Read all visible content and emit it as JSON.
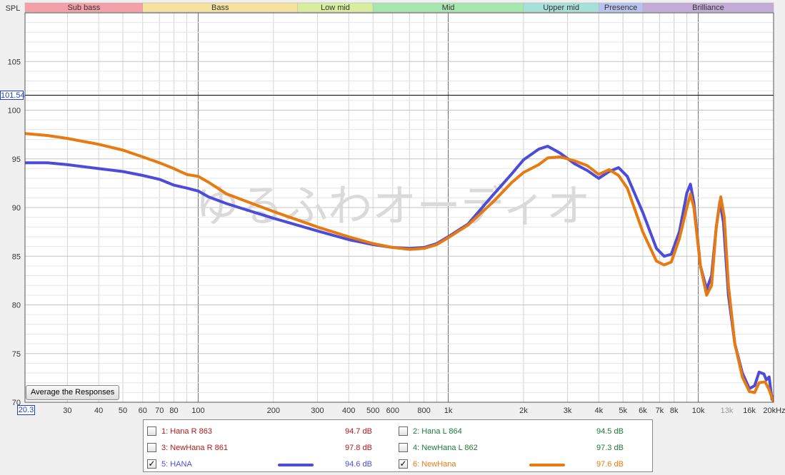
{
  "chart_data": {
    "type": "line",
    "ylabel": "SPL",
    "xscale": "log",
    "xlim": [
      20.3,
      20000
    ],
    "ylim": [
      70,
      110
    ],
    "cursor_value": "101.54",
    "cursor_db": 101.54,
    "x_cursor_label": "20.3",
    "yticks": [
      70,
      75,
      80,
      85,
      90,
      95,
      100,
      105
    ],
    "xticks": [
      {
        "f": 30,
        "label": "30"
      },
      {
        "f": 40,
        "label": "40"
      },
      {
        "f": 50,
        "label": "50"
      },
      {
        "f": 60,
        "label": "60"
      },
      {
        "f": 70,
        "label": "70"
      },
      {
        "f": 80,
        "label": "80"
      },
      {
        "f": 100,
        "label": "100"
      },
      {
        "f": 200,
        "label": "200"
      },
      {
        "f": 300,
        "label": "300"
      },
      {
        "f": 400,
        "label": "400"
      },
      {
        "f": 500,
        "label": "500"
      },
      {
        "f": 600,
        "label": "600"
      },
      {
        "f": 800,
        "label": "800"
      },
      {
        "f": 1000,
        "label": "1k"
      },
      {
        "f": 2000,
        "label": "2k"
      },
      {
        "f": 3000,
        "label": "3k"
      },
      {
        "f": 4000,
        "label": "4k"
      },
      {
        "f": 5000,
        "label": "5k"
      },
      {
        "f": 6000,
        "label": "6k"
      },
      {
        "f": 7000,
        "label": "7k"
      },
      {
        "f": 8000,
        "label": "8k"
      },
      {
        "f": 10000,
        "label": "10k"
      },
      {
        "f": 13000,
        "label": "13k",
        "dim": true
      },
      {
        "f": 16000,
        "label": "16k"
      },
      {
        "f": 20000,
        "label": "20kHz"
      }
    ],
    "bands": [
      {
        "name": "Sub bass",
        "from": 20.3,
        "to": 60,
        "color": "#f5a0a8"
      },
      {
        "name": "Bass",
        "from": 60,
        "to": 250,
        "color": "#f7e3a0"
      },
      {
        "name": "Low mid",
        "from": 250,
        "to": 500,
        "color": "#d8ee9e"
      },
      {
        "name": "Mid",
        "from": 500,
        "to": 2000,
        "color": "#a8e6b0"
      },
      {
        "name": "Upper mid",
        "from": 2000,
        "to": 4000,
        "color": "#a6e0d8"
      },
      {
        "name": "Presence",
        "from": 4000,
        "to": 6000,
        "color": "#b8c4ee"
      },
      {
        "name": "Brilliance",
        "from": 6000,
        "to": 20000,
        "color": "#c4acd8"
      }
    ],
    "watermark": "ゆるふわオーディオ",
    "series": [
      {
        "name": "HANA",
        "color": "#4c4cd8",
        "points": [
          [
            20.3,
            94.6
          ],
          [
            25,
            94.6
          ],
          [
            30,
            94.4
          ],
          [
            40,
            94.0
          ],
          [
            50,
            93.7
          ],
          [
            60,
            93.3
          ],
          [
            70,
            92.9
          ],
          [
            80,
            92.3
          ],
          [
            90,
            92.0
          ],
          [
            100,
            91.7
          ],
          [
            110,
            91.1
          ],
          [
            130,
            90.4
          ],
          [
            150,
            89.9
          ],
          [
            200,
            88.9
          ],
          [
            300,
            87.6
          ],
          [
            400,
            86.7
          ],
          [
            500,
            86.2
          ],
          [
            600,
            85.9
          ],
          [
            700,
            85.8
          ],
          [
            800,
            85.9
          ],
          [
            900,
            86.3
          ],
          [
            1000,
            87.0
          ],
          [
            1200,
            88.3
          ],
          [
            1500,
            91.2
          ],
          [
            1800,
            93.5
          ],
          [
            2000,
            94.9
          ],
          [
            2300,
            96.0
          ],
          [
            2500,
            96.3
          ],
          [
            2800,
            95.6
          ],
          [
            3200,
            94.5
          ],
          [
            3600,
            93.8
          ],
          [
            4000,
            93.0
          ],
          [
            4400,
            93.7
          ],
          [
            4800,
            94.1
          ],
          [
            5200,
            93.2
          ],
          [
            6000,
            89.5
          ],
          [
            6800,
            85.8
          ],
          [
            7300,
            85.0
          ],
          [
            7800,
            85.2
          ],
          [
            8400,
            87.5
          ],
          [
            9000,
            91.5
          ],
          [
            9300,
            92.4
          ],
          [
            9600,
            90.5
          ],
          [
            10200,
            84.0
          ],
          [
            10800,
            81.6
          ],
          [
            11300,
            83.0
          ],
          [
            11800,
            88.0
          ],
          [
            12200,
            90.6
          ],
          [
            12600,
            88.5
          ],
          [
            13200,
            81.0
          ],
          [
            14000,
            76.0
          ],
          [
            15000,
            73.0
          ],
          [
            16000,
            71.4
          ],
          [
            16800,
            71.7
          ],
          [
            17500,
            73.1
          ],
          [
            18300,
            72.9
          ],
          [
            18700,
            72.3
          ],
          [
            19200,
            72.6
          ],
          [
            19700,
            70.3
          ],
          [
            20000,
            70.6
          ]
        ]
      },
      {
        "name": "NewHana",
        "color": "#e87a12",
        "points": [
          [
            20.3,
            97.6
          ],
          [
            25,
            97.4
          ],
          [
            30,
            97.1
          ],
          [
            40,
            96.5
          ],
          [
            50,
            95.9
          ],
          [
            60,
            95.2
          ],
          [
            70,
            94.6
          ],
          [
            80,
            94.0
          ],
          [
            90,
            93.4
          ],
          [
            100,
            93.2
          ],
          [
            110,
            92.6
          ],
          [
            130,
            91.4
          ],
          [
            150,
            90.8
          ],
          [
            200,
            89.6
          ],
          [
            300,
            88.0
          ],
          [
            400,
            87.0
          ],
          [
            500,
            86.3
          ],
          [
            600,
            85.9
          ],
          [
            700,
            85.7
          ],
          [
            800,
            85.8
          ],
          [
            900,
            86.2
          ],
          [
            1000,
            86.9
          ],
          [
            1200,
            88.2
          ],
          [
            1500,
            90.5
          ],
          [
            1800,
            92.6
          ],
          [
            2000,
            93.6
          ],
          [
            2300,
            94.4
          ],
          [
            2500,
            95.1
          ],
          [
            2800,
            95.2
          ],
          [
            3200,
            94.8
          ],
          [
            3600,
            94.3
          ],
          [
            4000,
            93.4
          ],
          [
            4400,
            93.9
          ],
          [
            4800,
            93.3
          ],
          [
            5200,
            92.0
          ],
          [
            6000,
            87.5
          ],
          [
            6800,
            84.5
          ],
          [
            7300,
            84.1
          ],
          [
            7800,
            84.4
          ],
          [
            8400,
            86.8
          ],
          [
            9000,
            90.0
          ],
          [
            9300,
            91.4
          ],
          [
            9600,
            90.0
          ],
          [
            10200,
            84.0
          ],
          [
            10800,
            81.0
          ],
          [
            11300,
            82.0
          ],
          [
            11800,
            88.0
          ],
          [
            12300,
            91.1
          ],
          [
            12700,
            89.0
          ],
          [
            13200,
            82.0
          ],
          [
            14000,
            76.0
          ],
          [
            15000,
            72.6
          ],
          [
            16000,
            71.1
          ],
          [
            16800,
            71.0
          ],
          [
            17500,
            72.0
          ],
          [
            18500,
            72.1
          ],
          [
            19200,
            71.3
          ],
          [
            20000,
            70.0
          ]
        ]
      }
    ]
  },
  "legend": {
    "button_label": "Average the Responses",
    "items": [
      {
        "label": "1: Hana R 863",
        "value": "94.7 dB",
        "checked": false,
        "color": "#b01818"
      },
      {
        "label": "2: Hana L 864",
        "value": "94.5 dB",
        "checked": false,
        "color": "#1c7a3a"
      },
      {
        "label": "3: NewHana R 861",
        "value": "97.8 dB",
        "checked": false,
        "color": "#b01818"
      },
      {
        "label": "4: NewHana L 862",
        "value": "97.3 dB",
        "checked": false,
        "color": "#1c7a3a"
      },
      {
        "label": "5: HANA",
        "value": "94.6 dB",
        "checked": true,
        "color": "#4c4cd8"
      },
      {
        "label": "6: NewHana",
        "value": "97.6 dB",
        "checked": true,
        "color": "#e87a12"
      }
    ],
    "check_mark": "✓"
  }
}
